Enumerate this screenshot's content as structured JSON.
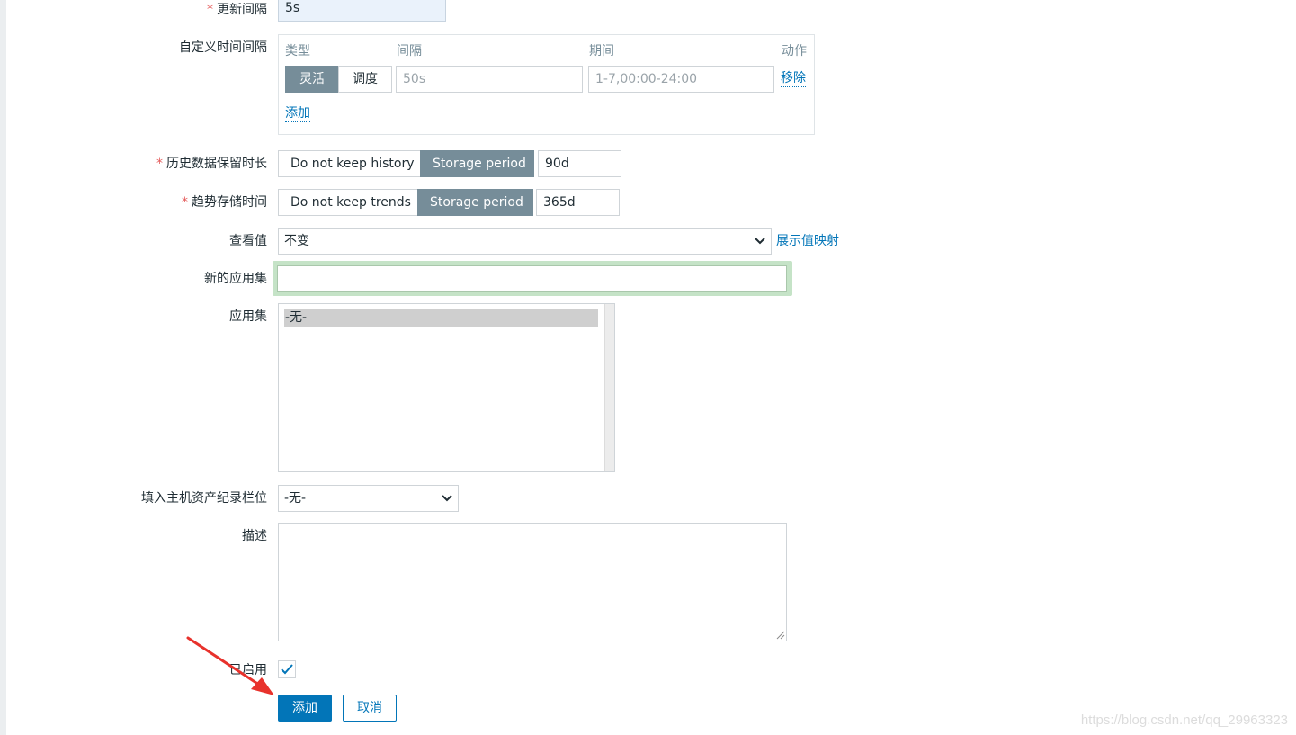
{
  "form": {
    "update_interval": {
      "label": "更新间隔",
      "value": "5s"
    },
    "custom_intervals": {
      "label": "自定义时间间隔",
      "headers": {
        "type": "类型",
        "interval": "间隔",
        "period": "期间",
        "action": "动作"
      },
      "row": {
        "type_options": [
          "灵活",
          "调度"
        ],
        "interval_placeholder": "50s",
        "period_placeholder": "1-7,00:00-24:00",
        "remove_label": "移除"
      },
      "add_label": "添加"
    },
    "history": {
      "label": "历史数据保留时长",
      "options": [
        "Do not keep history",
        "Storage period"
      ],
      "value": "90d"
    },
    "trends": {
      "label": "趋势存储时间",
      "options": [
        "Do not keep trends",
        "Storage period"
      ],
      "value": "365d"
    },
    "show_value": {
      "label": "查看值",
      "selected": "不变",
      "link_label": "展示值映射"
    },
    "new_application": {
      "label": "新的应用集",
      "value": ""
    },
    "applications": {
      "label": "应用集",
      "items": [
        "-无-"
      ]
    },
    "inventory": {
      "label": "填入主机资产纪录栏位",
      "selected": "-无-"
    },
    "description": {
      "label": "描述",
      "value": ""
    },
    "enabled": {
      "label": "已启用",
      "checked": true
    },
    "buttons": {
      "add": "添加",
      "cancel": "取消"
    }
  },
  "watermark": "https://blog.csdn.net/qq_29963323",
  "colors": {
    "accent": "#0275b8",
    "segment_active": "#768d99",
    "required": "#e45959",
    "arrow": "#e8322c",
    "focus_glow": "#c5e3c7"
  }
}
